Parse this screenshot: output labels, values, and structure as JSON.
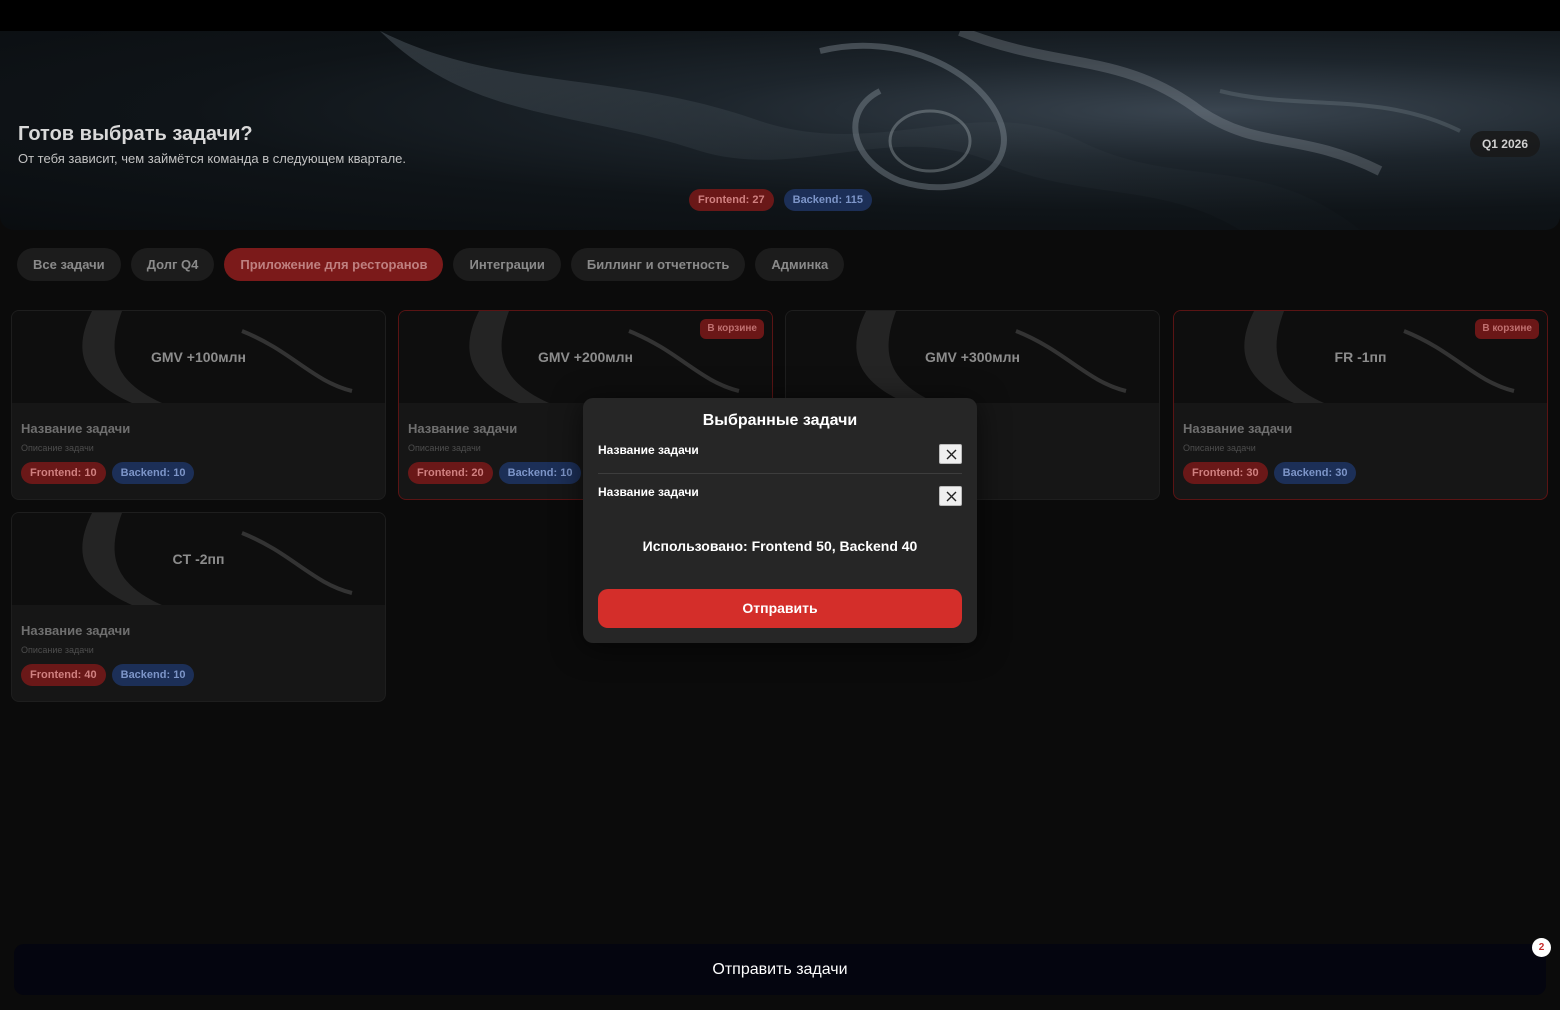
{
  "hero": {
    "title": "Готов выбрать задачи?",
    "subtitle": "От тебя зависит, чем займётся команда в следующем квартале.",
    "quarter": "Q1 2026",
    "frontend_total": "Frontend: 27",
    "backend_total": "Backend: 115"
  },
  "filters": [
    {
      "label": "Все задачи",
      "active": false
    },
    {
      "label": "Долг Q4",
      "active": false
    },
    {
      "label": "Приложение для ресторанов",
      "active": true
    },
    {
      "label": "Интеграции",
      "active": false
    },
    {
      "label": "Биллинг и отчетность",
      "active": false
    },
    {
      "label": "Админка",
      "active": false
    }
  ],
  "cards": [
    {
      "cover": "GMV +100млн",
      "in_cart": false,
      "name": "Название задачи",
      "desc": "Описание задачи",
      "frontend": "Frontend: 10",
      "backend": "Backend: 10"
    },
    {
      "cover": "GMV +200млн",
      "in_cart": true,
      "badge": "В корзине",
      "name": "Название задачи",
      "desc": "Описание задачи",
      "frontend": "Frontend: 20",
      "backend": "Backend: 10"
    },
    {
      "cover": "GMV +300млн",
      "in_cart": false,
      "name": "Название задачи",
      "desc": "Описание задачи",
      "frontend": "",
      "backend": ""
    },
    {
      "cover": "FR -1пп",
      "in_cart": true,
      "badge": "В корзине",
      "name": "Название задачи",
      "desc": "Описание задачи",
      "frontend": "Frontend: 30",
      "backend": "Backend: 30"
    },
    {
      "cover": "CT -2пп",
      "in_cart": false,
      "name": "Название задачи",
      "desc": "Описание задачи",
      "frontend": "Frontend: 40",
      "backend": "Backend: 10"
    }
  ],
  "modal": {
    "title": "Выбранные задачи",
    "items": [
      {
        "name": "Название задачи"
      },
      {
        "name": "Название задачи"
      }
    ],
    "summary": "Использовано: Frontend 50, Backend 40",
    "send_label": "Отправить"
  },
  "submit_bar": {
    "label": "Отправить задачи",
    "count": "2"
  },
  "icons": {
    "remove": "close-icon"
  },
  "colors": {
    "accent": "#d42e2a",
    "frontend_chip": "#6a1818",
    "backend_chip": "#1c2f57",
    "background": "#0b0b0b"
  }
}
